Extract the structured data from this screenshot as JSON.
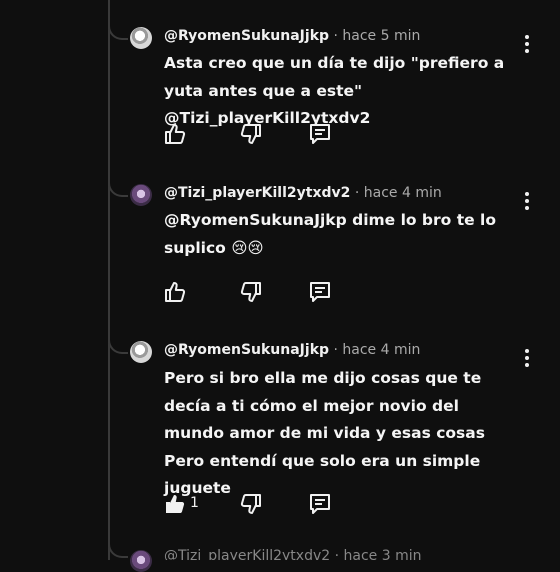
{
  "comments": [
    {
      "author": "@RyomenSukunaJjkp",
      "separator": " · ",
      "time": "hace 5 min",
      "text": "Asta creo que un día te dijo \"prefiero a yuta antes que a este\" @Tizi_playerKill2ytxdv2",
      "like_count": ""
    },
    {
      "author": "@Tizi_playerKill2ytxdv2",
      "separator": " · ",
      "time": "hace 4 min",
      "text": " @RyomenSukunaJjkp dime lo bro te lo suplico 😢😢",
      "like_count": ""
    },
    {
      "author": "@RyomenSukunaJjkp",
      "separator": " · ",
      "time": "hace 4 min",
      "text": "Pero si bro ella me dijo cosas que te decía a ti cómo el mejor novio del mundo amor de mi vida y esas cosas Pero entendí que solo era un simple juguete",
      "like_count": "1"
    }
  ],
  "partial_next": "@Tizi_playerKill2ytxdv2 · hace 3 min",
  "icons": {
    "like": "thumbs-up-icon",
    "dislike": "thumbs-down-icon",
    "reply": "reply-comment-icon",
    "menu": "more-vert-icon"
  }
}
